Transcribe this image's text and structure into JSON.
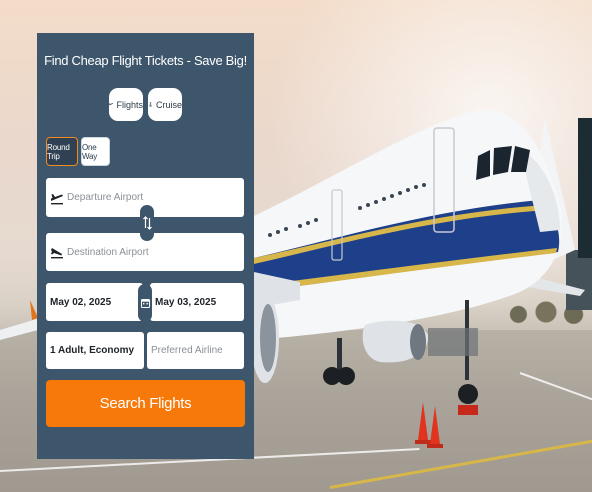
{
  "search": {
    "title": "Find Cheap Flight Tickets - Save Big!",
    "modes": [
      {
        "label": "Flights",
        "icon": "plane-icon"
      },
      {
        "label": "Cruise",
        "icon": "anchor-icon"
      }
    ],
    "trip_types": [
      {
        "label": "Round Trip",
        "selected": true
      },
      {
        "label": "One Way",
        "selected": false
      }
    ],
    "departure_placeholder": "Departure Airport",
    "destination_placeholder": "Destination Airport",
    "depart_date": "May 02, 2025",
    "return_date": "May 03, 2025",
    "passengers": "1 Adult, Economy",
    "airline_placeholder": "Preferred Airline",
    "search_label": "Search Flights"
  },
  "colors": {
    "panel": "#3e566b",
    "accent": "#f7790a",
    "active_border": "#f28a1e"
  }
}
